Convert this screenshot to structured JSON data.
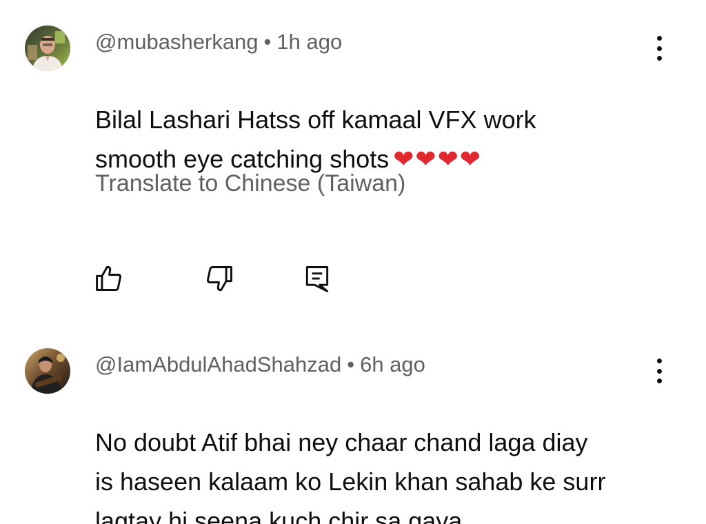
{
  "comments": [
    {
      "handle": "@mubasherkang",
      "separator": "•",
      "time": "1h ago",
      "text": "Bilal Lashari Hatss off kamaal VFX work\nsmooth eye catching shots",
      "emoji": "❤❤❤❤",
      "translate_label": "Translate to Chinese (Taiwan)",
      "avatar_icon": "user-avatar-icon",
      "menu_icon": "more-vert-icon"
    },
    {
      "handle": "@IamAbdulAhadShahzad",
      "separator": "•",
      "time": "6h ago",
      "text": "No doubt Atif bhai ney chaar chand laga diay\nis haseen kalaam ko Lekin khan sahab ke surr\nlagtay hi seena kuch chir sa gaya",
      "avatar_icon": "user-avatar-icon",
      "menu_icon": "more-vert-icon"
    }
  ],
  "actions": {
    "like_icon": "thumb-up-icon",
    "dislike_icon": "thumb-down-icon",
    "reply_icon": "reply-icon"
  },
  "colors": {
    "text_primary": "#0f0f0f",
    "text_secondary": "#606060",
    "heart": "#e0282e"
  }
}
